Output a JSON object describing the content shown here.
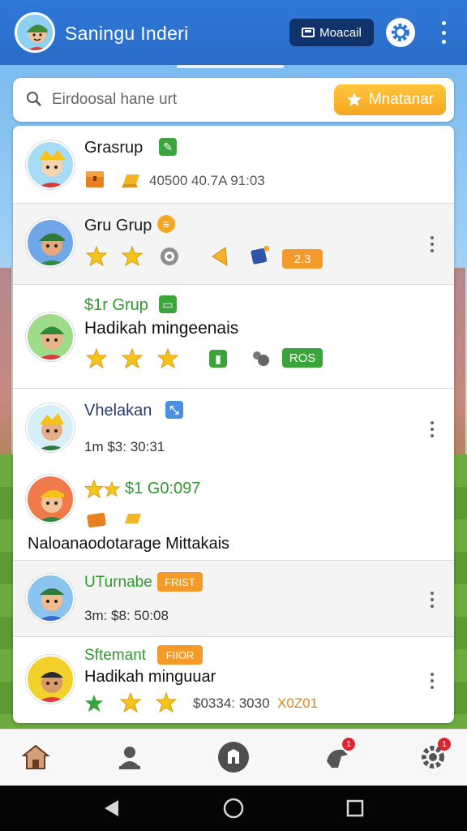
{
  "header": {
    "title": "Saningu Inderi",
    "mode_button": "Moacail",
    "avatar_icon": "user-avatar-icon",
    "gear_icon": "gear-icon",
    "more_icon": "more-vertical-icon"
  },
  "search": {
    "placeholder": "Eirdoosal hane urt",
    "action_label": "Mnatanar",
    "action_icon": "star-icon"
  },
  "rows": [
    {
      "name": "Grasrup",
      "meta": "40500 40.7A 91:03",
      "badge_icon": "edit-icon"
    },
    {
      "name": "Gru Grup",
      "tag": "2.3",
      "badge_icon": "coin-icon"
    },
    {
      "name": "$1r Grup",
      "subtitle": "Hadikah mingeenais",
      "tag": "ROS",
      "badge_icon": "chat-icon"
    },
    {
      "name": "Vhelakan",
      "meta": "1m  $3: 30:31",
      "badge_icon": "resize-icon"
    },
    {
      "name": "$1 G0:097",
      "subtitle": "Naloanaodotarage Mittakais"
    },
    {
      "name": "UTurnabe",
      "tag": "FRIST",
      "meta": "3m: $8: 50:08"
    },
    {
      "name": "Sftemant",
      "tag": "FIIOR",
      "subtitle": "Hadikah minguuar",
      "meta": "$0334: 3030",
      "meta_extra": "X0Z01"
    }
  ],
  "nav": {
    "items": [
      "home-icon",
      "profile-icon",
      "battle-icon",
      "guild-icon",
      "settings-icon"
    ],
    "badge_4": "1",
    "badge_5": "1"
  },
  "system": {
    "back_icon": "back-icon",
    "home_icon": "home-circle-icon",
    "recents_icon": "recents-icon"
  },
  "colors": {
    "primary": "#2f78d8",
    "accent": "#f6a623",
    "green": "#3aa53a",
    "dark_button": "#10336b"
  }
}
